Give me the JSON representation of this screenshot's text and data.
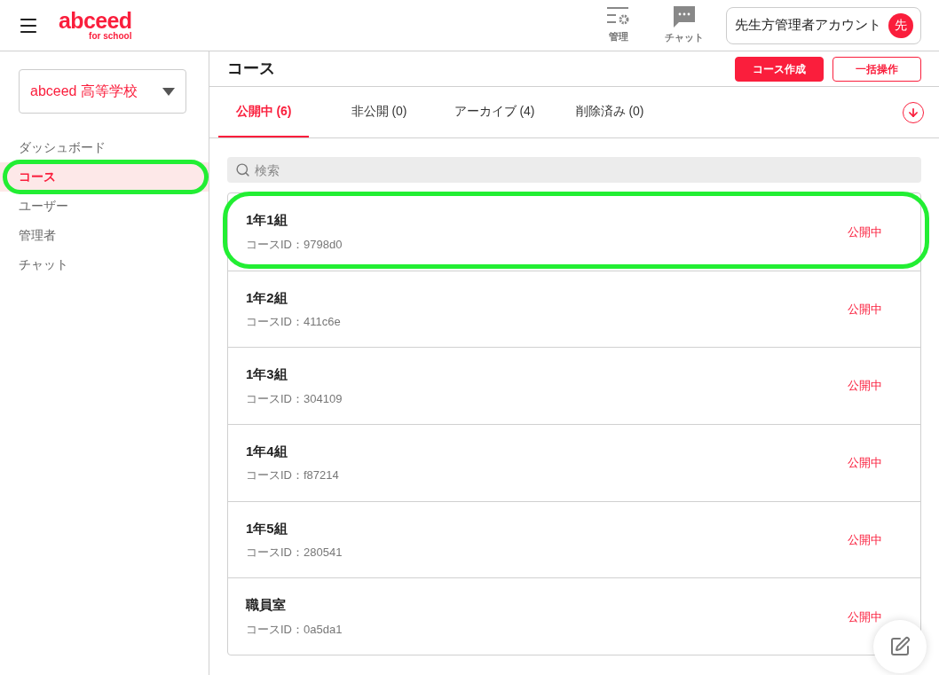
{
  "header": {
    "logo": "abceed",
    "logo_sub": "for school",
    "tools": [
      {
        "kind": "manage",
        "label": "管理"
      },
      {
        "kind": "chat",
        "label": "チャット"
      }
    ],
    "account": {
      "name": "先生方管理者アカウント",
      "avatar": "先"
    }
  },
  "sidebar": {
    "school": "abceed 高等学校",
    "items": [
      {
        "label": "ダッシュボード",
        "selected": false,
        "highlighted": false
      },
      {
        "label": "コース",
        "selected": true,
        "highlighted": true
      },
      {
        "label": "ユーザー",
        "selected": false,
        "highlighted": false
      },
      {
        "label": "管理者",
        "selected": false,
        "highlighted": false
      },
      {
        "label": "チャット",
        "selected": false,
        "highlighted": false
      }
    ]
  },
  "page": {
    "title": "コース",
    "buttons": [
      {
        "kind": "primary",
        "label": "コース作成"
      },
      {
        "kind": "outline",
        "label": "一括操作"
      }
    ]
  },
  "tabs": [
    {
      "label": "公開中 (6)",
      "selected": true
    },
    {
      "label": "非公開 (0)",
      "selected": false
    },
    {
      "label": "アーカイブ (4)",
      "selected": false
    },
    {
      "label": "削除済み (0)",
      "selected": false
    }
  ],
  "search": {
    "placeholder": "検索"
  },
  "courses": [
    {
      "name": "1年1組",
      "id": "コースID：9798d0",
      "status": "公開中",
      "highlighted": true
    },
    {
      "name": "1年2組",
      "id": "コースID：411c6e",
      "status": "公開中",
      "highlighted": false
    },
    {
      "name": "1年3組",
      "id": "コースID：304109",
      "status": "公開中",
      "highlighted": false
    },
    {
      "name": "1年4組",
      "id": "コースID：f87214",
      "status": "公開中",
      "highlighted": false
    },
    {
      "name": "1年5組",
      "id": "コースID：280541",
      "status": "公開中",
      "highlighted": false
    },
    {
      "name": "職員室",
      "id": "コースID：0a5da1",
      "status": "公開中",
      "highlighted": false
    }
  ]
}
